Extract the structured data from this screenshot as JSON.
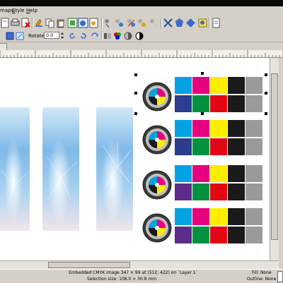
{
  "menu": {
    "items": [
      {
        "label": "maps",
        "underline_index": -1
      },
      {
        "label": "Style",
        "underline_index": 0
      },
      {
        "label": "Help",
        "underline_index": 0
      }
    ]
  },
  "toolbar2": {
    "rotate_label": "Rotate:",
    "rotate_value": "0.0"
  },
  "status": {
    "line1": "Embedded CMYK image 347 × 99 at (512, 422) on `Layer 1`",
    "line2": "Selection size: 108.0 × 30.8 mm",
    "fill": "Fill: None",
    "outline": "Outline: None"
  },
  "colors": {
    "cyan": "#00a3e0",
    "magenta": "#e6007e",
    "yellow": "#ffed00",
    "black": "#1a1a1a",
    "gray": "#9a9a9a",
    "darkblue_row1": "#2a3d8f",
    "green": "#00923f",
    "red": "#e30613",
    "purple_row3": "#5b2c8a"
  }
}
